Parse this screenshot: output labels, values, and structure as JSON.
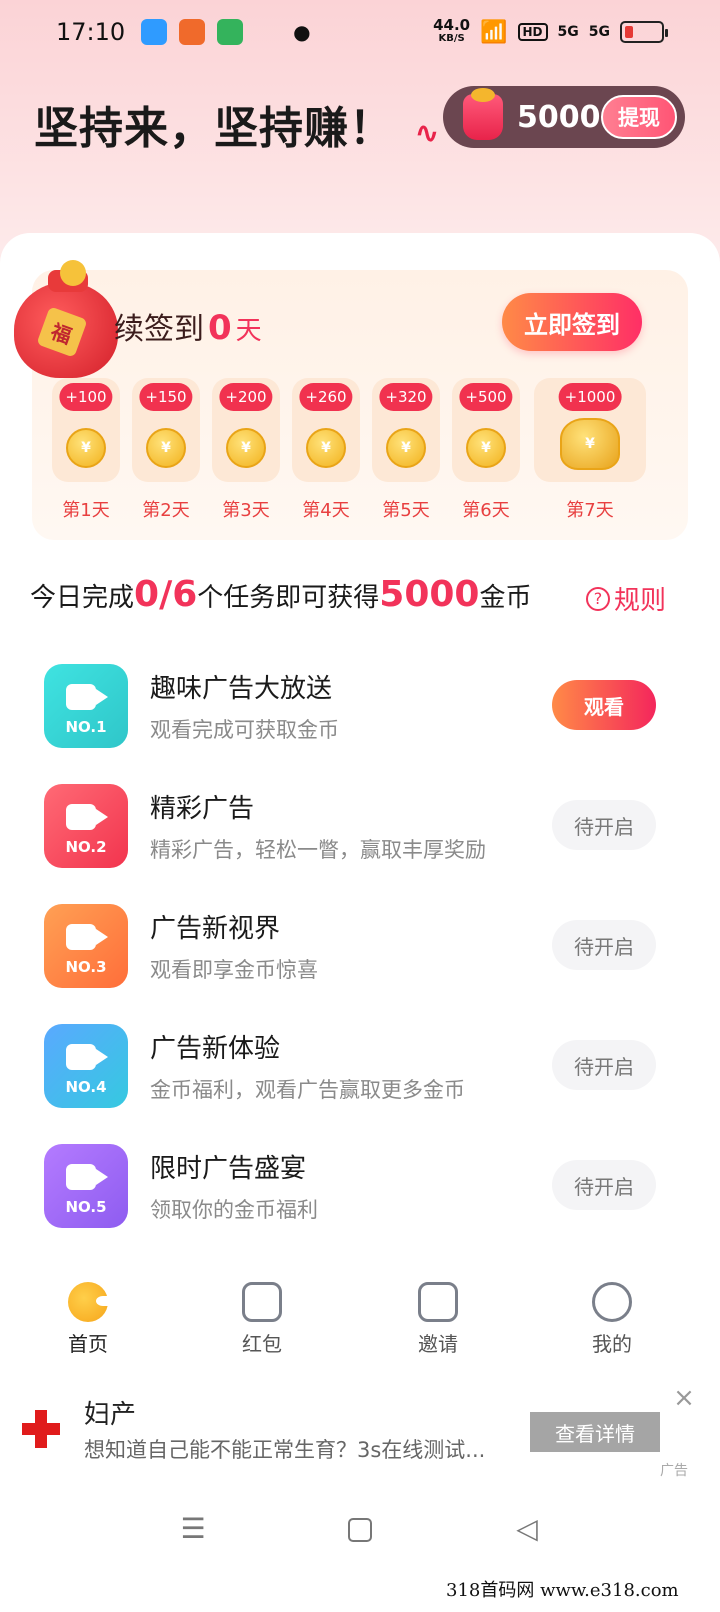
{
  "status_bar": {
    "time": "17:10",
    "net_speed_value": "44.0",
    "net_speed_unit": "KB/S",
    "hd": "HD",
    "sig1": "5G",
    "sig2": "5G"
  },
  "header": {
    "slogan": "坚持来，坚持赚！",
    "coin_balance": "5000",
    "withdraw_label": "提现"
  },
  "signin": {
    "title_prefix": "续签到",
    "days": "0",
    "unit": "天",
    "button_label": "立即签到",
    "bag_char": "福",
    "coin_symbol": "¥",
    "rewards": [
      {
        "bonus": "+100",
        "label": "第1天"
      },
      {
        "bonus": "+150",
        "label": "第2天"
      },
      {
        "bonus": "+200",
        "label": "第3天"
      },
      {
        "bonus": "+260",
        "label": "第4天"
      },
      {
        "bonus": "+320",
        "label": "第5天"
      },
      {
        "bonus": "+500",
        "label": "第6天"
      },
      {
        "bonus": "+1000",
        "label": "第7天"
      }
    ]
  },
  "tasks": {
    "summary_pre": "今日完成",
    "summary_progress": "0/6",
    "summary_mid": "个任务即可获得",
    "summary_reward": "5000",
    "summary_unit": "金币",
    "rules_label": "规则",
    "rules_icon": "?",
    "items": [
      {
        "no": "NO.1",
        "title": "趣味广告大放送",
        "desc": "观看完成可获取金币",
        "action": "观看"
      },
      {
        "no": "NO.2",
        "title": "精彩广告",
        "desc": "精彩广告，轻松一瞥，赢取丰厚奖励",
        "action": "待开启"
      },
      {
        "no": "NO.3",
        "title": "广告新视界",
        "desc": "观看即享金币惊喜",
        "action": "待开启"
      },
      {
        "no": "NO.4",
        "title": "广告新体验",
        "desc": "金币福利，观看广告赢取更多金币",
        "action": "待开启"
      },
      {
        "no": "NO.5",
        "title": "限时广告盛宴",
        "desc": "领取你的金币福利",
        "action": "待开启"
      }
    ]
  },
  "bottom_nav": {
    "items": [
      {
        "label": "首页",
        "icon": "home-icon"
      },
      {
        "label": "红包",
        "icon": "red-packet-icon"
      },
      {
        "label": "邀请",
        "icon": "invite-icon"
      },
      {
        "label": "我的",
        "icon": "profile-icon"
      }
    ]
  },
  "ad": {
    "title": "妇产",
    "desc": "想知道自己能不能正常生育？3s在线测试...",
    "button_label": "查看详情",
    "tag": "广告",
    "close": "×"
  },
  "system_nav": {
    "menu": "☰",
    "back": "◁"
  },
  "watermark": "318首码网 www.e318.com"
}
